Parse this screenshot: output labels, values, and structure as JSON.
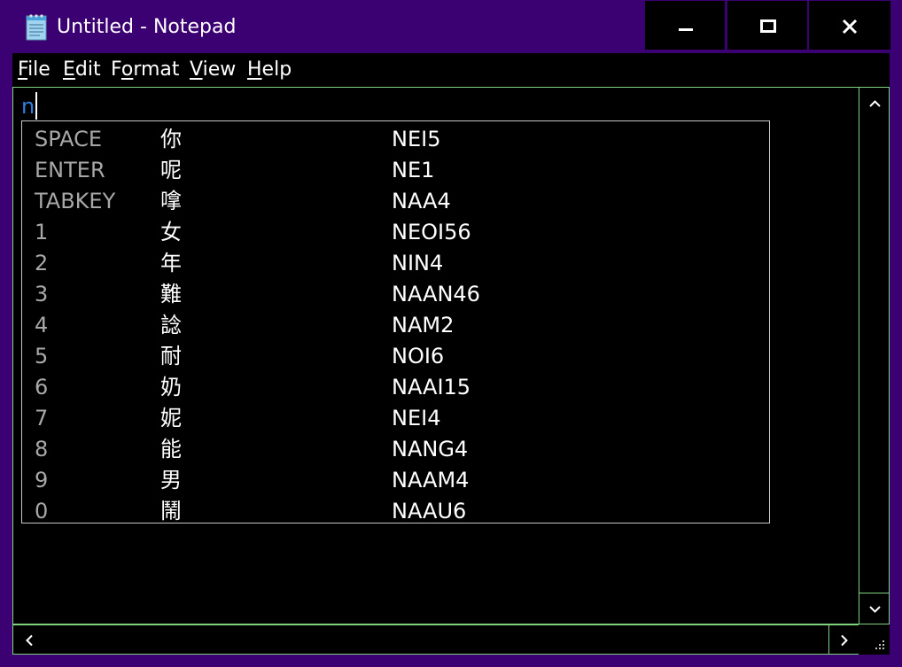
{
  "window": {
    "title": "Untitled - Notepad",
    "app_icon": "notepad-icon",
    "caption_buttons": {
      "minimize_icon": "minimize-icon",
      "maximize_icon": "maximize-icon",
      "close_icon": "close-icon"
    },
    "colors": {
      "frame": "#3b0072",
      "background": "#000000",
      "text": "#ffffff",
      "border": "#7fd37f",
      "typed_text": "#2f7fe0",
      "key_label": "#a8a8a8"
    }
  },
  "menubar": {
    "items": [
      {
        "accel": "F",
        "rest": "ile"
      },
      {
        "accel": "E",
        "rest": "dit"
      },
      {
        "pre": "F",
        "accel": "o",
        "rest": "rmat"
      },
      {
        "accel": "V",
        "rest": "iew"
      },
      {
        "accel": "H",
        "rest": "elp"
      }
    ]
  },
  "editor": {
    "text": "n"
  },
  "ime_candidates": {
    "rows": [
      {
        "key": "SPACE",
        "char": "你",
        "code": "NEI5"
      },
      {
        "key": "ENTER",
        "char": "呢",
        "code": "NE1"
      },
      {
        "key": "TABKEY",
        "char": "嗱",
        "code": "NAA4"
      },
      {
        "key": "1",
        "char": "女",
        "code": "NEOI56"
      },
      {
        "key": "2",
        "char": "年",
        "code": "NIN4"
      },
      {
        "key": "3",
        "char": "難",
        "code": "NAAN46"
      },
      {
        "key": "4",
        "char": "諗",
        "code": "NAM2"
      },
      {
        "key": "5",
        "char": "耐",
        "code": "NOI6"
      },
      {
        "key": "6",
        "char": "奶",
        "code": "NAAI15"
      },
      {
        "key": "7",
        "char": "妮",
        "code": "NEI4"
      },
      {
        "key": "8",
        "char": "能",
        "code": "NANG4"
      },
      {
        "key": "9",
        "char": "男",
        "code": "NAAM4"
      },
      {
        "key": "0",
        "char": "鬧",
        "code": "NAAU6"
      }
    ]
  },
  "scrollbars": {
    "up_icon": "chevron-up-icon",
    "down_icon": "chevron-down-icon",
    "left_icon": "chevron-left-icon",
    "right_icon": "chevron-right-icon",
    "grip_icon": "resize-grip-icon"
  }
}
